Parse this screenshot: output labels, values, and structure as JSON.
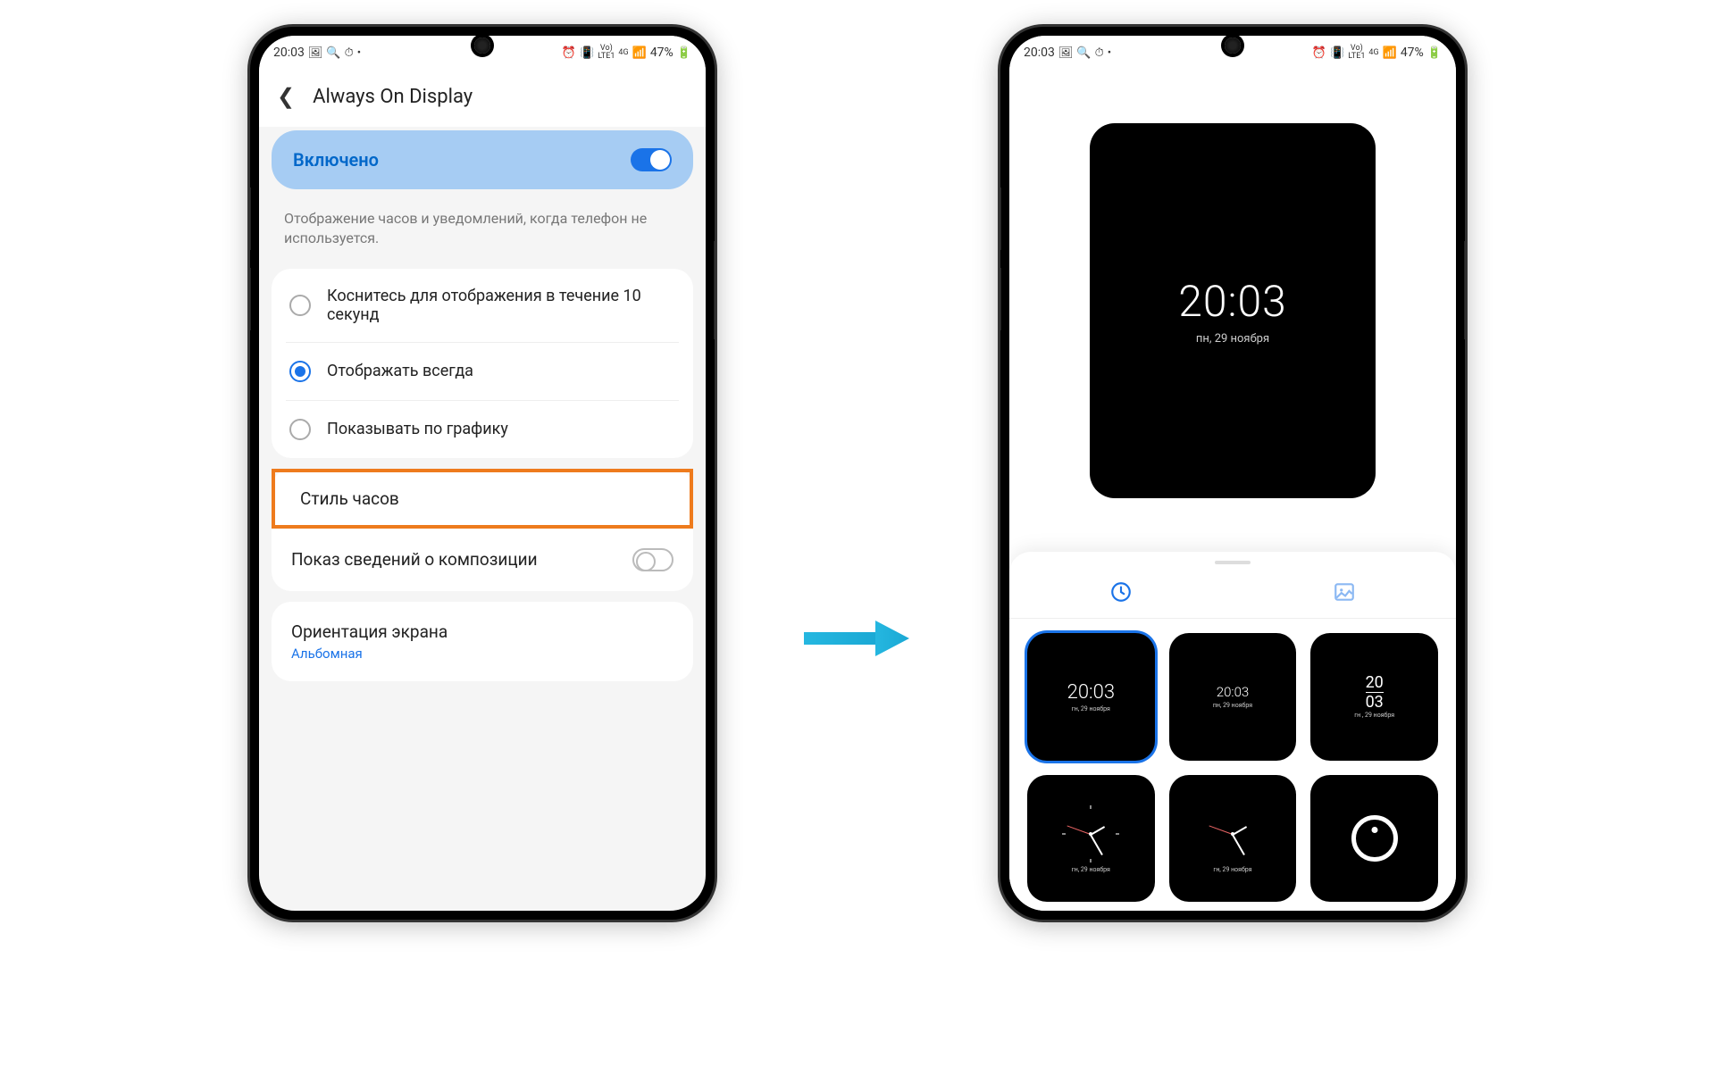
{
  "status": {
    "time": "20:03",
    "battery": "47%",
    "net": "4G",
    "lte": "LTE1",
    "vo": "Vo)"
  },
  "phone1": {
    "title": "Always On Display",
    "enabled_label": "Включено",
    "description": "Отображение часов и уведомлений, когда телефон не используется.",
    "radio_options": [
      "Коснитесь для отображения в течение 10 секунд",
      "Отображать всегда",
      "Показывать по графику"
    ],
    "clock_style": "Стиль часов",
    "show_composition": "Показ сведений о композиции",
    "orientation_label": "Ориентация экрана",
    "orientation_value": "Альбомная"
  },
  "phone2": {
    "preview_time": "20:03",
    "preview_date": "пн, 29 ноября",
    "tiles": [
      {
        "type": "digital-large",
        "time": "20:03",
        "date": "гн, 29 ноября"
      },
      {
        "type": "digital-med",
        "time": "20:03",
        "date": "пн, 29 ноября"
      },
      {
        "type": "digital-vert",
        "hh": "20",
        "mm": "03",
        "date": "гн , 29 ноября"
      },
      {
        "type": "analog-roman",
        "date": "гн, 29 ноября"
      },
      {
        "type": "analog-modern",
        "date": "гн, 29 ноября"
      },
      {
        "type": "ring"
      }
    ]
  }
}
